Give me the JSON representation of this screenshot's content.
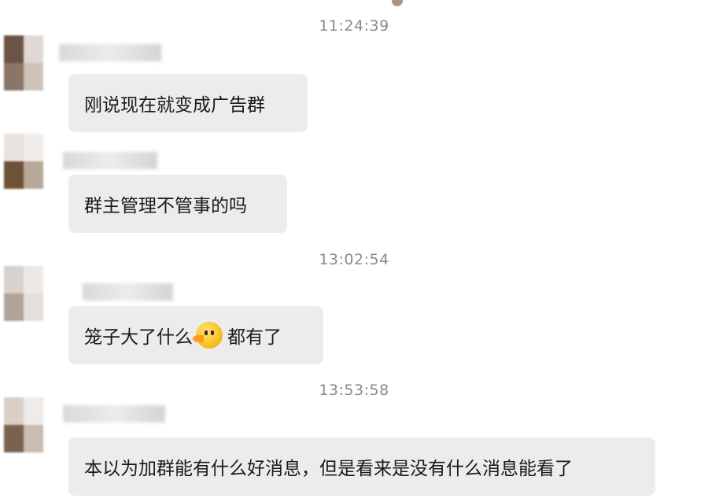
{
  "chat": {
    "timestamps": [
      "11:24:39",
      "13:02:54",
      "13:53:58"
    ],
    "messages": [
      {
        "text": "刚说现在就变成广告群"
      },
      {
        "text": "群主管理不管事的吗"
      },
      {
        "text_before": "笼子大了什么",
        "emoji": "duck-emoji",
        "text_after": "都有了"
      },
      {
        "text": "本以为加群能有什么好消息，但是看来是没有什么消息能看了"
      }
    ]
  },
  "colors": {
    "background": "#ffffff",
    "bubble": "#ececec",
    "timestamp_text": "#8a8a8a",
    "message_text": "#1a1a1a"
  }
}
